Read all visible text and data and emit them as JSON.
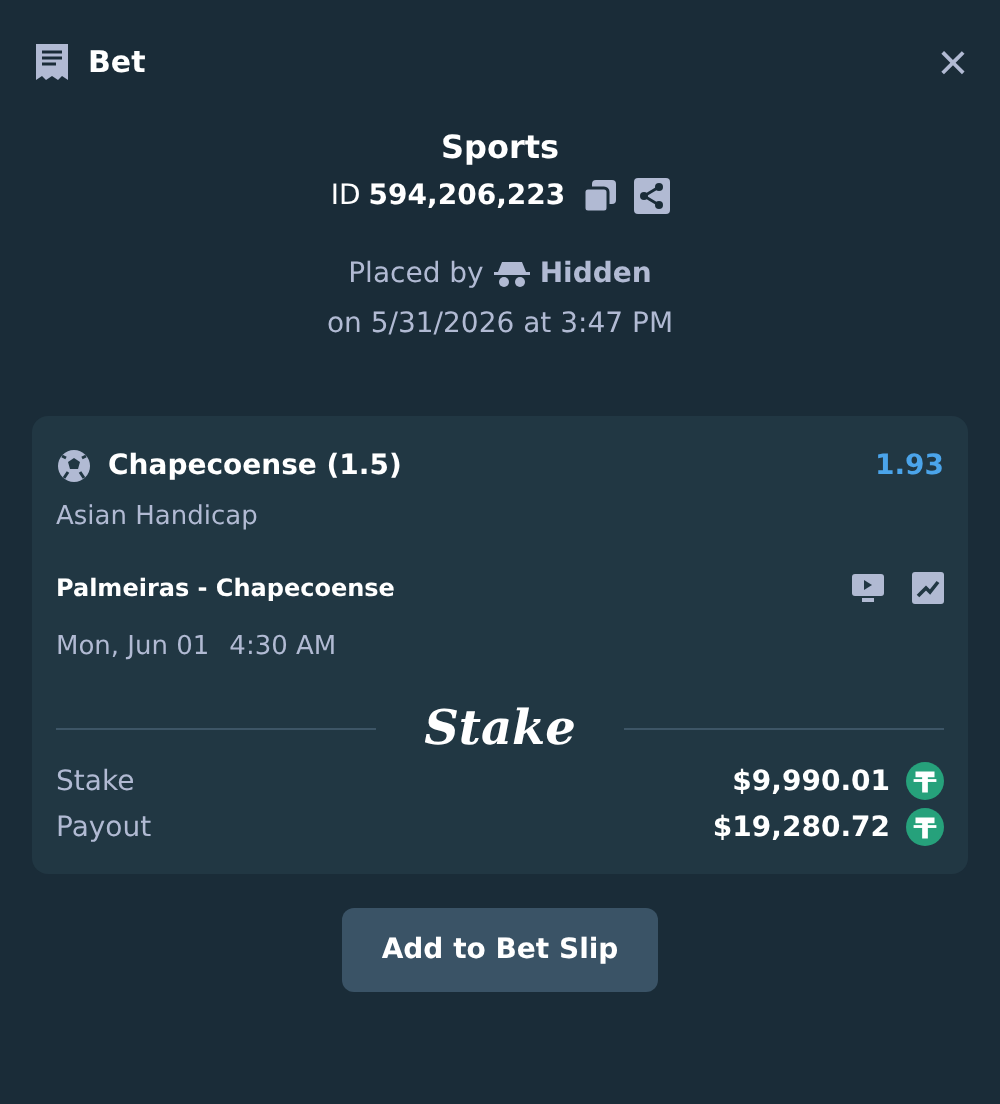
{
  "header": {
    "title": "Bet",
    "close": "×"
  },
  "summary": {
    "category": "Sports",
    "id_label": "ID",
    "id": "594,206,223",
    "placed_by_label": "Placed by",
    "user": "Hidden",
    "placed_on": "on 5/31/2026 at 3:47 PM"
  },
  "selection": {
    "team": "Chapecoense (1.5)",
    "odds": "1.93",
    "market": "Asian Handicap",
    "event": "Palmeiras - Chapecoense",
    "date": "Mon, Jun 01",
    "time": "4:30 AM"
  },
  "brand": "Stake",
  "amounts": [
    {
      "label": "Stake",
      "value": "$9,990.01"
    },
    {
      "label": "Payout",
      "value": "$19,280.72"
    }
  ],
  "action": "Add to Bet Slip"
}
